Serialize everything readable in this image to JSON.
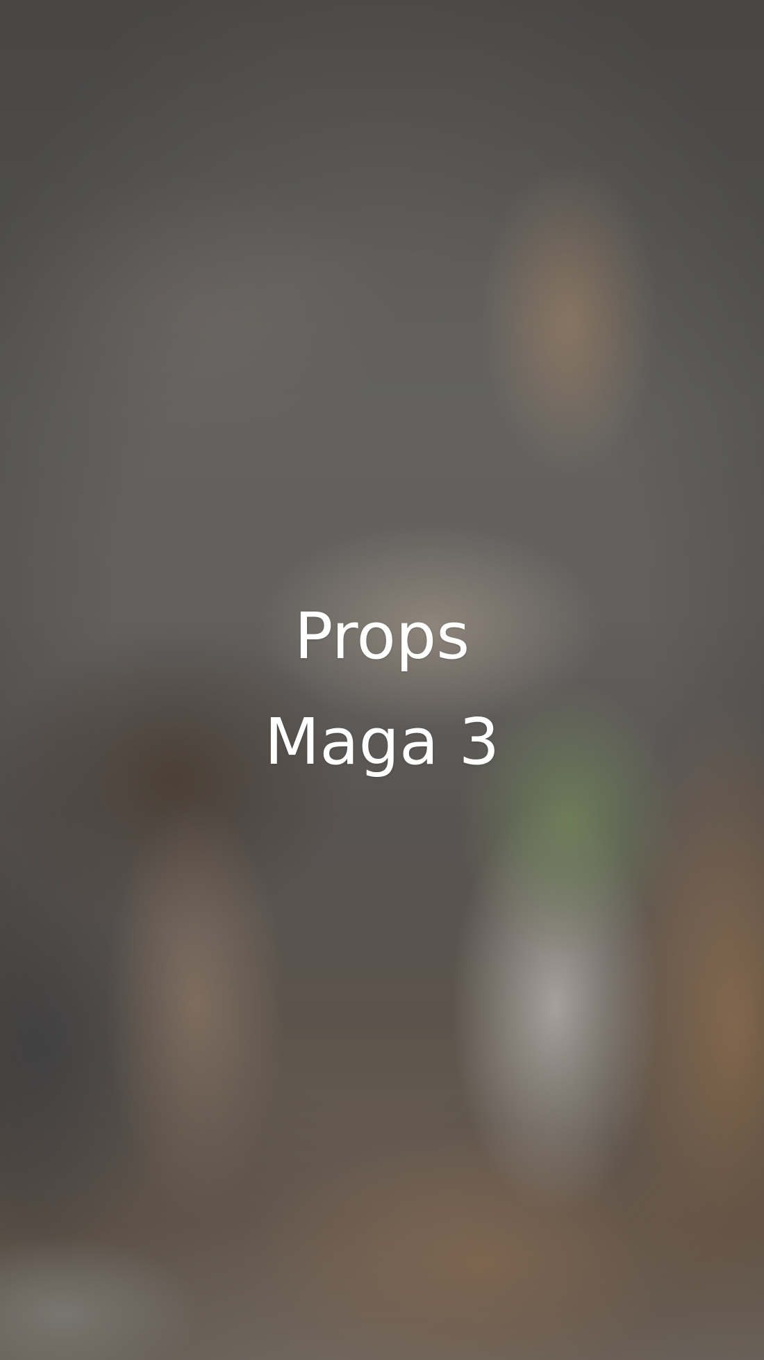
{
  "title": {
    "line1": "Props",
    "line2": "Maga 3"
  },
  "text_color": "#ffffff"
}
